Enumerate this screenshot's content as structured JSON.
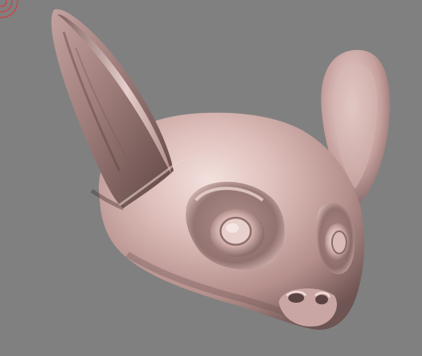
{
  "viewport": {
    "background_color": "#808080",
    "model_base_color": "#c9a6a3",
    "model_shadow_color": "#5a4342",
    "model_highlight_color": "#f3e1de",
    "gizmo_color": "#d93a3a",
    "gizmo_icon": "rotate-gizmo-icon",
    "model_icon": "sculpted-creature-head"
  }
}
